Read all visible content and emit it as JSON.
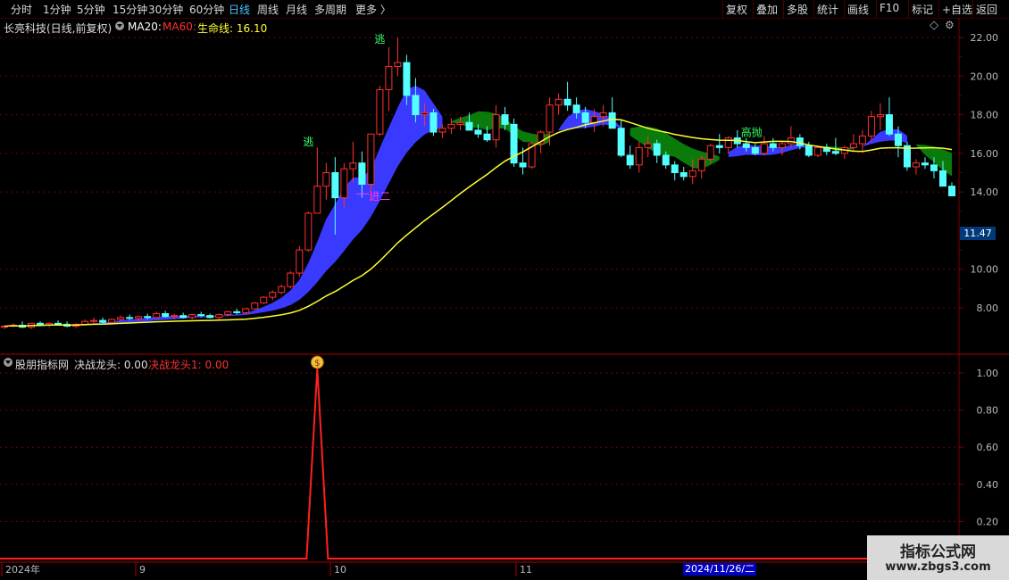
{
  "toolbar": {
    "left": [
      "分时",
      "1分钟",
      "5分钟",
      "15分钟",
      "30分钟",
      "60分钟",
      "日线",
      "周线",
      "月线",
      "多周期",
      "更多 〉"
    ],
    "right": [
      "复权",
      "叠加",
      "多股",
      "统计",
      "画线",
      "F10",
      "标记",
      "+自选",
      "返回"
    ]
  },
  "main": {
    "stock": "长亮科技(日线,前复权)",
    "ma20": "MA20:",
    "ma60": "MA60:",
    "life_line": "生命线: 16.10",
    "price_tag": "11.47",
    "signals": {
      "escape": "逃",
      "enter2": "进二",
      "sell": "高抛"
    },
    "y_ticks": [
      "22.00",
      "20.00",
      "18.00",
      "16.00",
      "14.00",
      "10.00",
      "8.00"
    ]
  },
  "sub": {
    "site": "股朋指标网",
    "jz": "决战龙头: 0.00",
    "jz1": "决战龙头1: 0.00",
    "y_ticks": [
      "1.00",
      "0.80",
      "0.60",
      "0.40",
      "0.20"
    ],
    "marker": "$"
  },
  "xaxis": {
    "labels": [
      "2024年",
      "9",
      "10",
      "11"
    ],
    "cursor_date": "2024/11/26/二"
  },
  "watermark": {
    "line1": "指标公式网",
    "line2": "www.zbgs3.com"
  },
  "colors": {
    "up": "#ff3030",
    "down": "#54ffff",
    "bull_band": "#3a3aff",
    "bear_band": "#0a7a0a",
    "life": "#ffff33",
    "grid": "#7a0000"
  },
  "chart_data": {
    "type": "candlestick",
    "title": "长亮科技(日线,前复权)",
    "ylim": [
      6.2,
      22.6
    ],
    "life_line_last": 16.1,
    "candles": [
      [
        7.0,
        7.1,
        6.9,
        7.05
      ],
      [
        7.05,
        7.2,
        7.0,
        7.1
      ],
      [
        7.1,
        7.3,
        6.95,
        7.0
      ],
      [
        7.0,
        7.2,
        6.9,
        7.2
      ],
      [
        7.2,
        7.3,
        7.05,
        7.1
      ],
      [
        7.1,
        7.25,
        7.0,
        7.2
      ],
      [
        7.2,
        7.35,
        7.1,
        7.15
      ],
      [
        7.15,
        7.3,
        7.0,
        7.05
      ],
      [
        7.05,
        7.2,
        6.95,
        7.15
      ],
      [
        7.15,
        7.4,
        7.1,
        7.3
      ],
      [
        7.3,
        7.5,
        7.2,
        7.35
      ],
      [
        7.35,
        7.5,
        7.2,
        7.25
      ],
      [
        7.25,
        7.45,
        7.15,
        7.4
      ],
      [
        7.4,
        7.6,
        7.3,
        7.5
      ],
      [
        7.5,
        7.65,
        7.35,
        7.45
      ],
      [
        7.45,
        7.6,
        7.3,
        7.55
      ],
      [
        7.55,
        7.7,
        7.4,
        7.5
      ],
      [
        7.5,
        7.8,
        7.45,
        7.7
      ],
      [
        7.7,
        7.85,
        7.5,
        7.55
      ],
      [
        7.55,
        7.7,
        7.4,
        7.6
      ],
      [
        7.6,
        7.75,
        7.45,
        7.5
      ],
      [
        7.5,
        7.7,
        7.4,
        7.65
      ],
      [
        7.65,
        7.8,
        7.5,
        7.6
      ],
      [
        7.6,
        7.7,
        7.45,
        7.5
      ],
      [
        7.5,
        7.7,
        7.4,
        7.65
      ],
      [
        7.65,
        7.85,
        7.55,
        7.8
      ],
      [
        7.8,
        7.95,
        7.65,
        7.75
      ],
      [
        7.75,
        8.0,
        7.7,
        7.95
      ],
      [
        7.95,
        8.3,
        7.9,
        8.25
      ],
      [
        8.25,
        8.6,
        8.2,
        8.55
      ],
      [
        8.55,
        8.9,
        8.4,
        8.8
      ],
      [
        8.8,
        9.2,
        8.7,
        9.1
      ],
      [
        9.1,
        9.9,
        9.0,
        9.8
      ],
      [
        9.8,
        11.2,
        9.6,
        11.0
      ],
      [
        11.0,
        13.0,
        10.9,
        12.9
      ],
      [
        12.9,
        16.3,
        12.9,
        14.3
      ],
      [
        14.3,
        15.5,
        13.6,
        15.0
      ],
      [
        15.0,
        15.8,
        11.8,
        13.7
      ],
      [
        13.7,
        15.5,
        13.2,
        15.2
      ],
      [
        15.2,
        16.6,
        14.5,
        15.5
      ],
      [
        15.5,
        16.1,
        13.7,
        14.4
      ],
      [
        14.4,
        17.0,
        13.5,
        17.0
      ],
      [
        17.0,
        19.5,
        16.9,
        19.3
      ],
      [
        19.3,
        21.5,
        18.2,
        20.5
      ],
      [
        20.5,
        22.0,
        20.0,
        20.7
      ],
      [
        20.7,
        21.1,
        18.5,
        19.0
      ],
      [
        19.0,
        19.9,
        17.6,
        18.0
      ],
      [
        18.0,
        18.6,
        17.4,
        18.1
      ],
      [
        18.1,
        18.3,
        16.9,
        17.1
      ],
      [
        17.1,
        17.5,
        16.8,
        17.3
      ],
      [
        17.3,
        17.8,
        17.0,
        17.5
      ],
      [
        17.5,
        17.9,
        17.2,
        17.6
      ],
      [
        17.6,
        18.1,
        17.2,
        17.2
      ],
      [
        17.2,
        17.5,
        16.8,
        17.0
      ],
      [
        17.0,
        17.4,
        16.6,
        16.7
      ],
      [
        16.7,
        18.5,
        16.3,
        18.0
      ],
      [
        18.0,
        18.4,
        17.2,
        17.5
      ],
      [
        17.5,
        17.8,
        15.3,
        15.5
      ],
      [
        15.5,
        16.3,
        14.9,
        15.3
      ],
      [
        15.3,
        16.6,
        15.2,
        16.5
      ],
      [
        16.5,
        17.2,
        16.0,
        17.1
      ],
      [
        17.1,
        18.9,
        16.4,
        18.5
      ],
      [
        18.5,
        19.1,
        18.0,
        18.8
      ],
      [
        18.8,
        19.7,
        18.2,
        18.5
      ],
      [
        18.5,
        18.9,
        17.8,
        18.1
      ],
      [
        18.1,
        18.4,
        17.3,
        17.6
      ],
      [
        17.6,
        18.3,
        17.1,
        17.9
      ],
      [
        17.9,
        18.5,
        17.4,
        18.1
      ],
      [
        18.1,
        18.9,
        17.6,
        17.3
      ],
      [
        17.3,
        17.7,
        15.8,
        15.9
      ],
      [
        15.9,
        16.4,
        15.2,
        15.4
      ],
      [
        15.4,
        16.6,
        15.0,
        16.3
      ],
      [
        16.3,
        16.9,
        15.8,
        16.5
      ],
      [
        16.5,
        16.7,
        15.5,
        15.9
      ],
      [
        15.9,
        16.1,
        15.2,
        15.4
      ],
      [
        15.4,
        15.6,
        14.6,
        15.0
      ],
      [
        15.0,
        15.3,
        14.6,
        14.8
      ],
      [
        14.8,
        15.7,
        14.4,
        15.1
      ],
      [
        15.1,
        15.9,
        14.7,
        15.7
      ],
      [
        15.7,
        16.5,
        15.5,
        16.4
      ],
      [
        16.4,
        17.0,
        16.0,
        16.3
      ],
      [
        16.3,
        16.9,
        16.0,
        16.8
      ],
      [
        16.8,
        17.2,
        16.3,
        16.5
      ],
      [
        16.5,
        16.8,
        16.1,
        16.3
      ],
      [
        16.3,
        16.5,
        15.9,
        16.0
      ],
      [
        16.0,
        16.9,
        15.9,
        16.5
      ],
      [
        16.5,
        16.8,
        16.1,
        16.3
      ],
      [
        16.3,
        16.6,
        15.9,
        16.5
      ],
      [
        16.5,
        17.4,
        16.3,
        16.8
      ],
      [
        16.8,
        17.0,
        16.2,
        16.4
      ],
      [
        16.4,
        16.6,
        15.8,
        15.9
      ],
      [
        15.9,
        16.4,
        15.8,
        16.3
      ],
      [
        16.3,
        16.5,
        15.9,
        16.1
      ],
      [
        16.1,
        16.8,
        15.9,
        16.0
      ],
      [
        16.0,
        16.4,
        15.7,
        16.3
      ],
      [
        16.3,
        17.0,
        16.1,
        16.5
      ],
      [
        16.5,
        17.2,
        16.1,
        16.9
      ],
      [
        16.9,
        18.2,
        16.6,
        17.9
      ],
      [
        17.9,
        18.6,
        17.2,
        18.0
      ],
      [
        18.0,
        18.9,
        16.9,
        17.0
      ],
      [
        17.0,
        17.4,
        15.8,
        16.4
      ],
      [
        16.4,
        16.6,
        15.1,
        15.3
      ],
      [
        15.3,
        15.7,
        14.9,
        15.5
      ],
      [
        15.5,
        15.8,
        15.2,
        15.4
      ],
      [
        15.4,
        15.8,
        14.7,
        15.1
      ],
      [
        15.1,
        15.6,
        14.4,
        14.3
      ],
      [
        14.3,
        14.5,
        13.9,
        13.8
      ]
    ],
    "sub_series": {
      "name": "决战龙头",
      "spike_index": 35,
      "spike_value": 1.0,
      "ylim": [
        0,
        1.08
      ]
    }
  }
}
